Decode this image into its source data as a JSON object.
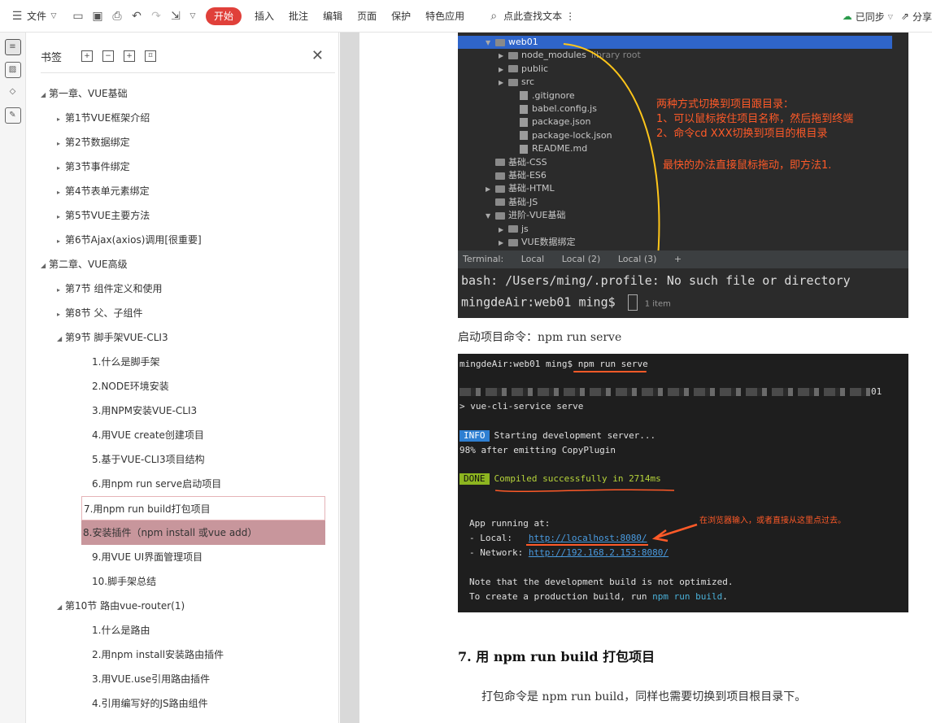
{
  "toolbar": {
    "menu_label": "文件",
    "tabs": [
      "开始",
      "插入",
      "批注",
      "编辑",
      "页面",
      "保护",
      "特色应用"
    ],
    "search_label": "点此查找文本",
    "sync_label": "已同步",
    "share_label": "分享"
  },
  "panel": {
    "title": "书签",
    "items": [
      {
        "label": "第一章、VUE基础",
        "level": 0,
        "arrow": "▲"
      },
      {
        "label": "第1节VUE框架介绍",
        "level": 1,
        "arrow": "▶"
      },
      {
        "label": "第2节数据绑定",
        "level": 1,
        "arrow": "▶"
      },
      {
        "label": "第3节事件绑定",
        "level": 1,
        "arrow": "▶"
      },
      {
        "label": "第4节表单元素绑定",
        "level": 1,
        "arrow": "▶"
      },
      {
        "label": "第5节VUE主要方法",
        "level": 1,
        "arrow": "▶"
      },
      {
        "label": "第6节Ajax(axios)调用[很重要]",
        "level": 1,
        "arrow": "▶"
      },
      {
        "label": "第二章、VUE高级",
        "level": 0,
        "arrow": "▲"
      },
      {
        "label": "第7节 组件定义和使用",
        "level": 1,
        "arrow": "▶"
      },
      {
        "label": "第8节 父、子组件",
        "level": 1,
        "arrow": "▶"
      },
      {
        "label": "第9节 脚手架VUE-CLI3",
        "level": 1,
        "arrow": "▲"
      },
      {
        "label": "1.什么是脚手架",
        "level": 2,
        "arrow": ""
      },
      {
        "label": "2.NODE环境安装",
        "level": 2,
        "arrow": ""
      },
      {
        "label": "3.用NPM安装VUE-CLI3",
        "level": 2,
        "arrow": ""
      },
      {
        "label": "4.用VUE create创建项目",
        "level": 2,
        "arrow": ""
      },
      {
        "label": "5.基于VUE-CLI3项目结构",
        "level": 2,
        "arrow": ""
      },
      {
        "label": "6.用npm run serve启动项目",
        "level": 2,
        "arrow": ""
      },
      {
        "label": "7.用npm run build打包项目",
        "level": 2,
        "arrow": "",
        "state": "outline"
      },
      {
        "label": "8.安装插件（npm install 或vue add）",
        "level": 2,
        "arrow": "",
        "state": "fill"
      },
      {
        "label": "9.用VUE UI界面管理项目",
        "level": 2,
        "arrow": ""
      },
      {
        "label": "10.脚手架总结",
        "level": 2,
        "arrow": ""
      },
      {
        "label": "第10节 路由vue-router(1)",
        "level": 1,
        "arrow": "▲"
      },
      {
        "label": "1.什么是路由",
        "level": 2,
        "arrow": ""
      },
      {
        "label": "2.用npm install安装路由插件",
        "level": 2,
        "arrow": ""
      },
      {
        "label": "3.用VUE.use引用路由插件",
        "level": 2,
        "arrow": ""
      },
      {
        "label": "4.引用编写好的JS路由组件",
        "level": 2,
        "arrow": ""
      }
    ]
  },
  "doc": {
    "shot1": {
      "tree": [
        {
          "label": "web01",
          "kind": "folder",
          "arrow": "▼",
          "indent": 1,
          "selected": true
        },
        {
          "label": "node_modules",
          "suffix": "library root",
          "kind": "folder",
          "arrow": "▶",
          "indent": 2
        },
        {
          "label": "public",
          "kind": "folder",
          "arrow": "▶",
          "indent": 2
        },
        {
          "label": "src",
          "kind": "folder",
          "arrow": "▶",
          "indent": 2
        },
        {
          "label": ".gitignore",
          "kind": "file",
          "arrow": "",
          "indent": 3
        },
        {
          "label": "babel.config.js",
          "kind": "file",
          "arrow": "",
          "indent": 3
        },
        {
          "label": "package.json",
          "kind": "file",
          "arrow": "",
          "indent": 3
        },
        {
          "label": "package-lock.json",
          "kind": "file",
          "arrow": "",
          "indent": 3
        },
        {
          "label": "README.md",
          "kind": "file",
          "arrow": "",
          "indent": 3
        },
        {
          "label": "基础-CSS",
          "kind": "folder",
          "arrow": "",
          "indent": 1
        },
        {
          "label": "基础-ES6",
          "kind": "folder",
          "arrow": "",
          "indent": 1
        },
        {
          "label": "基础-HTML",
          "kind": "folder",
          "arrow": "▶",
          "indent": 1
        },
        {
          "label": "基础-JS",
          "kind": "folder",
          "arrow": "",
          "indent": 1
        },
        {
          "label": "进阶-VUE基础",
          "kind": "folder",
          "arrow": "▼",
          "indent": 1
        },
        {
          "label": "js",
          "kind": "folder",
          "arrow": "▶",
          "indent": 2
        },
        {
          "label": "VUE数据绑定",
          "kind": "folder",
          "arrow": "▶",
          "indent": 2
        }
      ],
      "annotation_lines": [
        "两种方式切换到项目跟目录：",
        "1、可以鼠标按住项目名称，然后拖到终端",
        "2、命令cd XXX切换到项目的根目录"
      ],
      "annotation_tip": "最快的办法直接鼠标拖动，即方法1.",
      "term_tabs": [
        "Terminal:",
        "Local",
        "Local (2)",
        "Local (3)"
      ],
      "term_line1": "bash: /Users/ming/.profile: No such file or directory",
      "term_line2": "mingdeAir:web01 ming$",
      "term_item": "1 item"
    },
    "caption": "启动项目命令：npm run serve",
    "shot2": {
      "prompt": "mingdeAir:web01 ming$ ",
      "cmd": "npm run serve",
      "blur_end": "01",
      "serve_line": "> vue-cli-service serve",
      "info_badge": "INFO",
      "info_text": "Starting development server...",
      "emit_line": "98% after emitting CopyPlugin",
      "done_badge": "DONE",
      "done_text": "Compiled successfully in 2714ms",
      "app_running": "App running at:",
      "local_label": "- Local:   ",
      "local_url": "http://localhost:8080/",
      "network_label": "- Network: ",
      "network_url": "http://192.168.2.153:8080/",
      "note1": "Note that the development build is not optimized.",
      "note2_pre": "To create a production build, run ",
      "note2_cmd": "npm run build",
      "note2_post": ".",
      "annotation": "在浏览器输入，或者直接从这里点过去。"
    },
    "heading": "7.  用 npm run build 打包项目",
    "paragraph": "打包命令是 npm run build，同样也需要切换到项目根目录下。"
  },
  "colors": {
    "accent": "#e0403a",
    "selected_outline": "#e5b3b7",
    "selected_fill": "#c8969c",
    "annotation": "#ff5a28",
    "info_badge": "#2e7fd2",
    "done_badge": "#8db520",
    "done_text": "#b6d33a",
    "link": "#4a9be0"
  }
}
